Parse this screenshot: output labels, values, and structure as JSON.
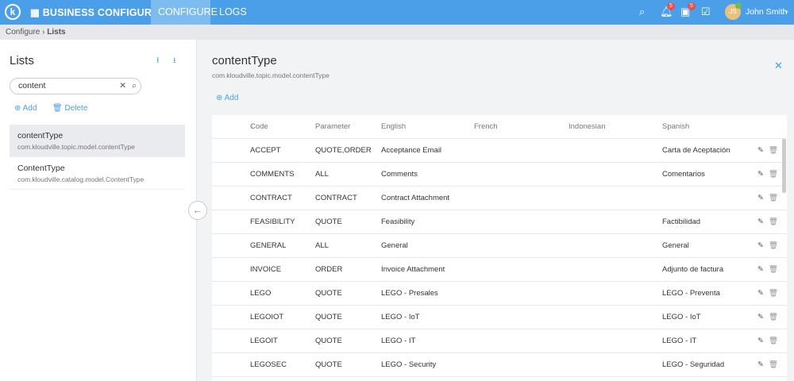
{
  "topbar": {
    "logo": "k",
    "app_title": "BUSINESS CONFIGURATOR",
    "tabs": [
      "CONFIGURE",
      "LOGS"
    ],
    "notifications_count": "5",
    "tasks_count": "5",
    "user_initials": "JS",
    "user_name": "John Smith"
  },
  "breadcrumb": {
    "items": [
      "Configure",
      "Lists"
    ]
  },
  "left": {
    "title": "Lists",
    "search_value": "content",
    "add_label": "Add",
    "delete_label": "Delete",
    "items": [
      {
        "name": "contentType",
        "path": "com.kloudville.topic.model.contentType"
      },
      {
        "name": "ContentType",
        "path": "com.kloudville.catalog.model.ContentType"
      }
    ]
  },
  "main": {
    "title": "contentType",
    "subtitle": "com.kloudville.topic.model.contentType",
    "add_label": "Add",
    "columns": [
      "Code",
      "Parameter",
      "English",
      "French",
      "Indonesian",
      "Spanish"
    ],
    "rows": [
      [
        "ACCEPT",
        "QUOTE,ORDER",
        "Acceptance Email",
        "",
        "",
        "Carta de Aceptación"
      ],
      [
        "COMMENTS",
        "ALL",
        "Comments",
        "",
        "",
        "Comentarios"
      ],
      [
        "CONTRACT",
        "CONTRACT",
        "Contract Attachment",
        "",
        "",
        ""
      ],
      [
        "FEASIBILITY",
        "QUOTE",
        "Feasibility",
        "",
        "",
        "Factibilidad"
      ],
      [
        "GENERAL",
        "ALL",
        "General",
        "",
        "",
        "General"
      ],
      [
        "INVOICE",
        "ORDER",
        "Invoice Attachment",
        "",
        "",
        "Adjunto de factura"
      ],
      [
        "LEGO",
        "QUOTE",
        "LEGO - Presales",
        "",
        "",
        "LEGO - Preventa"
      ],
      [
        "LEGOIOT",
        "QUOTE",
        "LEGO - IoT",
        "",
        "",
        "LEGO - IoT"
      ],
      [
        "LEGOIT",
        "QUOTE",
        "LEGO - IT",
        "",
        "",
        "LEGO - IT"
      ],
      [
        "LEGOSEC",
        "QUOTE",
        "LEGO - Security",
        "",
        "",
        "LEGO - Seguridad"
      ]
    ]
  }
}
